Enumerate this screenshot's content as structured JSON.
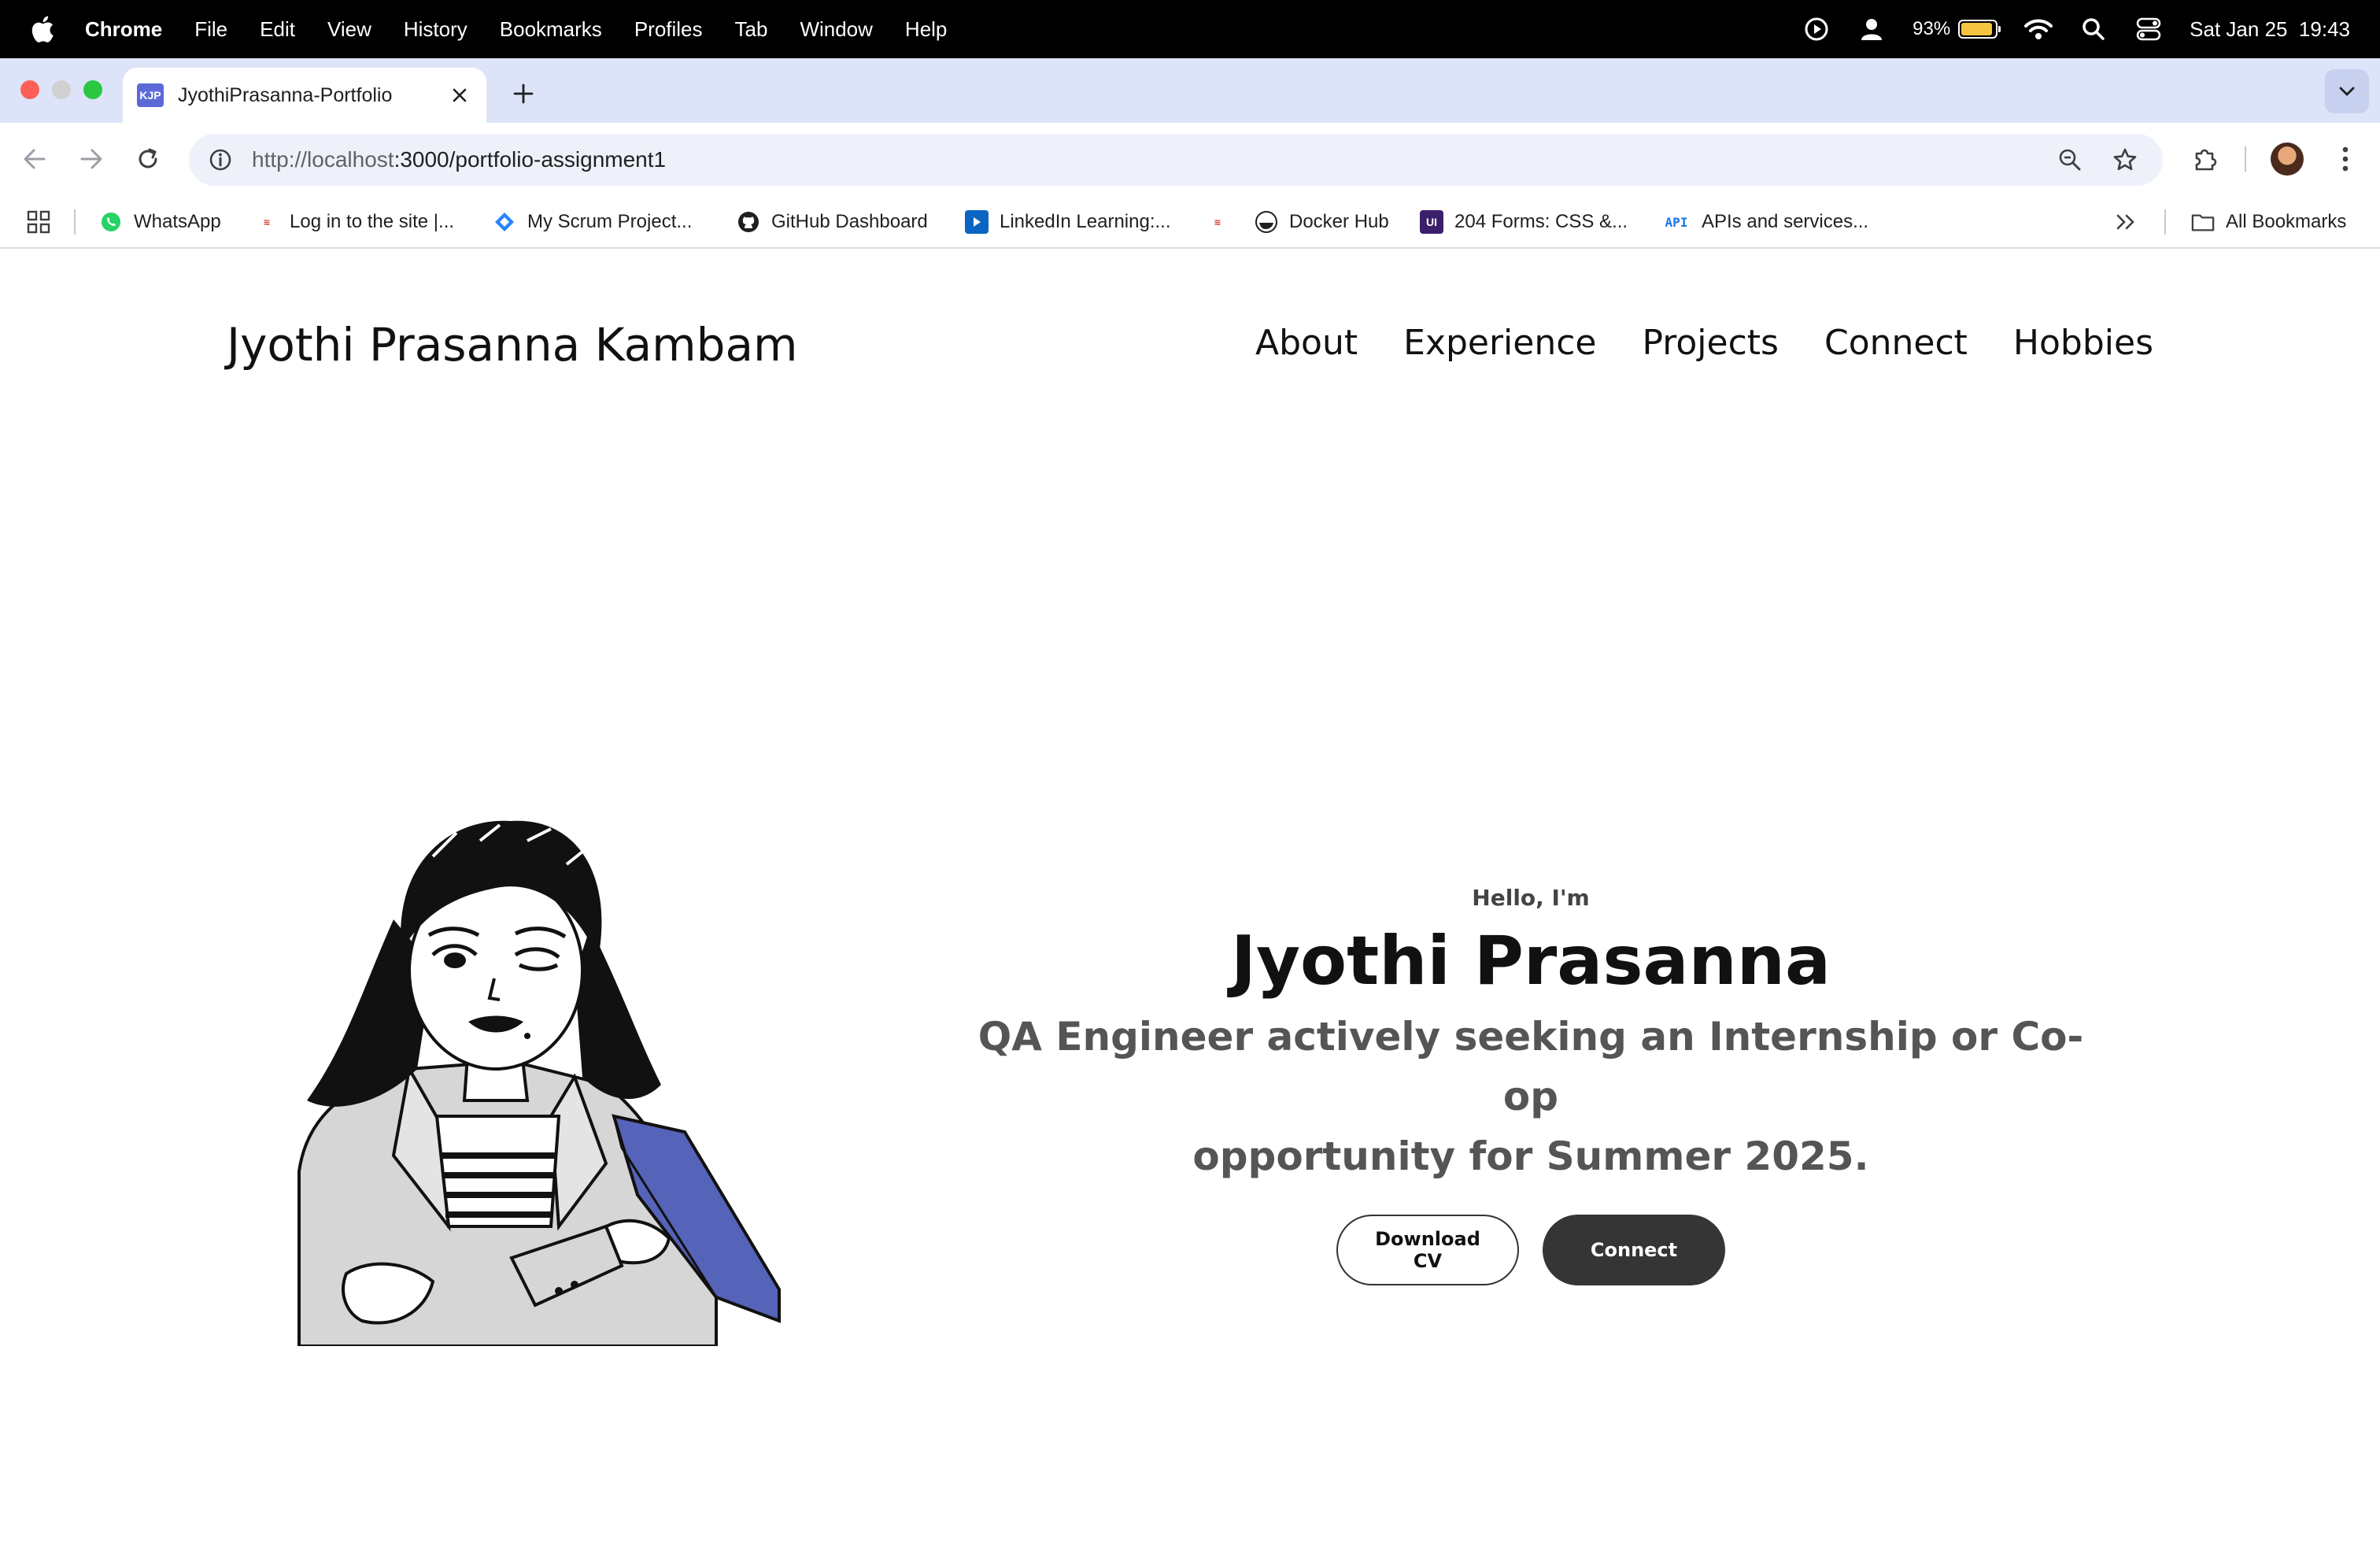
{
  "menubar": {
    "app": "Chrome",
    "items": [
      "File",
      "Edit",
      "View",
      "History",
      "Bookmarks",
      "Profiles",
      "Tab",
      "Window",
      "Help"
    ],
    "battery": "93%",
    "datetime": "Sat Jan 25  19:43"
  },
  "browser": {
    "tab": {
      "favicon": "KJP",
      "title": "JyothiPrasanna-Portfolio"
    },
    "url": {
      "host": "http://localhost",
      "path": ":3000/portfolio-assignment1"
    },
    "bookmarks": [
      {
        "label": "WhatsApp",
        "icon": "whatsapp-icon"
      },
      {
        "label": "Log in to the site |...",
        "icon": "site-icon"
      },
      {
        "label": "My Scrum Project...",
        "icon": "jira-icon"
      },
      {
        "label": "GitHub Dashboard",
        "icon": "github-icon"
      },
      {
        "label": "LinkedIn Learning:...",
        "icon": "linkedin-learning-icon"
      },
      {
        "label": "",
        "icon": "site-icon"
      },
      {
        "label": "Docker Hub",
        "icon": "docker-icon"
      },
      {
        "label": "204 Forms: CSS &...",
        "icon": "ui-icon"
      },
      {
        "label": "APIs and services...",
        "icon": "api-icon"
      }
    ],
    "all_bookmarks": "All Bookmarks"
  },
  "site": {
    "title": "Jyothi Prasanna Kambam",
    "nav": [
      "About",
      "Experience",
      "Projects",
      "Connect",
      "Hobbies"
    ]
  },
  "hero": {
    "greeting": "Hello, I'm",
    "name": "Jyothi Prasanna",
    "tagline_line1": "QA Engineer actively seeking an Internship or Co-op",
    "tagline_line2": "opportunity for Summer 2025.",
    "download_cv": "Download CV",
    "connect": "Connect"
  },
  "colors": {
    "accent_blue": "#5563b8",
    "button_dark": "#353535",
    "tabstrip": "#dde3f8"
  }
}
